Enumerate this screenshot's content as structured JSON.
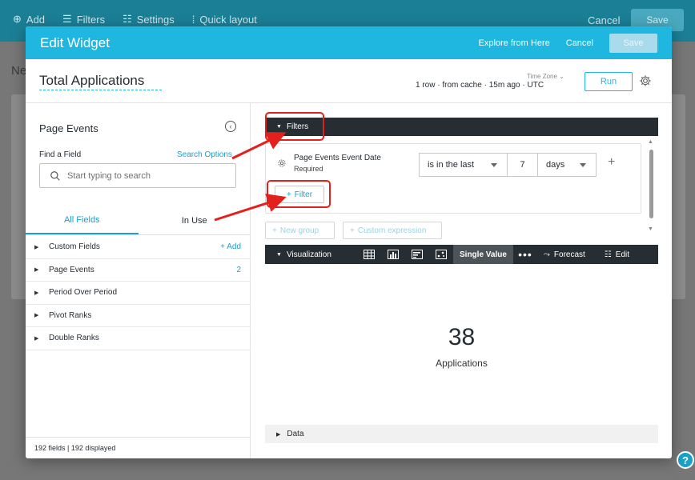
{
  "background": {
    "toolbar": {
      "add_label": "Add",
      "filters_label": "Filters",
      "settings_label": "Settings",
      "quick_layout_label": "Quick layout"
    },
    "cancel_label": "Cancel",
    "save_label": "Save",
    "title": "Ne",
    "help_label": "?"
  },
  "modal": {
    "title": "Edit Widget",
    "explore_label": "Explore from Here",
    "cancel_label": "Cancel",
    "save_label": "Save",
    "widget_title": "Total Applications",
    "timezone_label": "Time Zone",
    "query_info": "1 row · from cache · 15m ago · UTC",
    "run_label": "Run"
  },
  "left_panel": {
    "title": "Page Events",
    "find_label": "Find a Field",
    "search_options_label": "Search Options",
    "search_placeholder": "Start typing to search",
    "tabs": [
      "All Fields",
      "In Use"
    ],
    "active_tab": "All Fields",
    "fields": [
      {
        "label": "Custom Fields",
        "right": "+ Add"
      },
      {
        "label": "Page Events",
        "right": "2"
      },
      {
        "label": "Period Over Period",
        "right": ""
      },
      {
        "label": "Pivot Ranks",
        "right": ""
      },
      {
        "label": "Double Ranks",
        "right": ""
      }
    ],
    "footer": "192 fields | 192 displayed"
  },
  "filters": {
    "header": "Filters",
    "field_name": "Page Events Event Date",
    "required_label": "Required",
    "operator": "is in the last",
    "value": "7",
    "unit": "days",
    "add_filter_label": "Filter",
    "new_group_label": "New group",
    "custom_expression_label": "Custom expression"
  },
  "visualization": {
    "header": "Visualization",
    "icons": [
      "table-icon",
      "bar-chart-icon",
      "column-chart-icon",
      "scatter-icon"
    ],
    "active_type": "Single Value",
    "forecast_label": "Forecast",
    "edit_label": "Edit",
    "value": "38",
    "value_label": "Applications"
  },
  "data_section": {
    "label": "Data"
  },
  "colors": {
    "header_blue": "#1fb6e0",
    "dark_bar": "#262d33",
    "link_blue": "#1fa0c8",
    "annotation_red": "#e3201b"
  }
}
